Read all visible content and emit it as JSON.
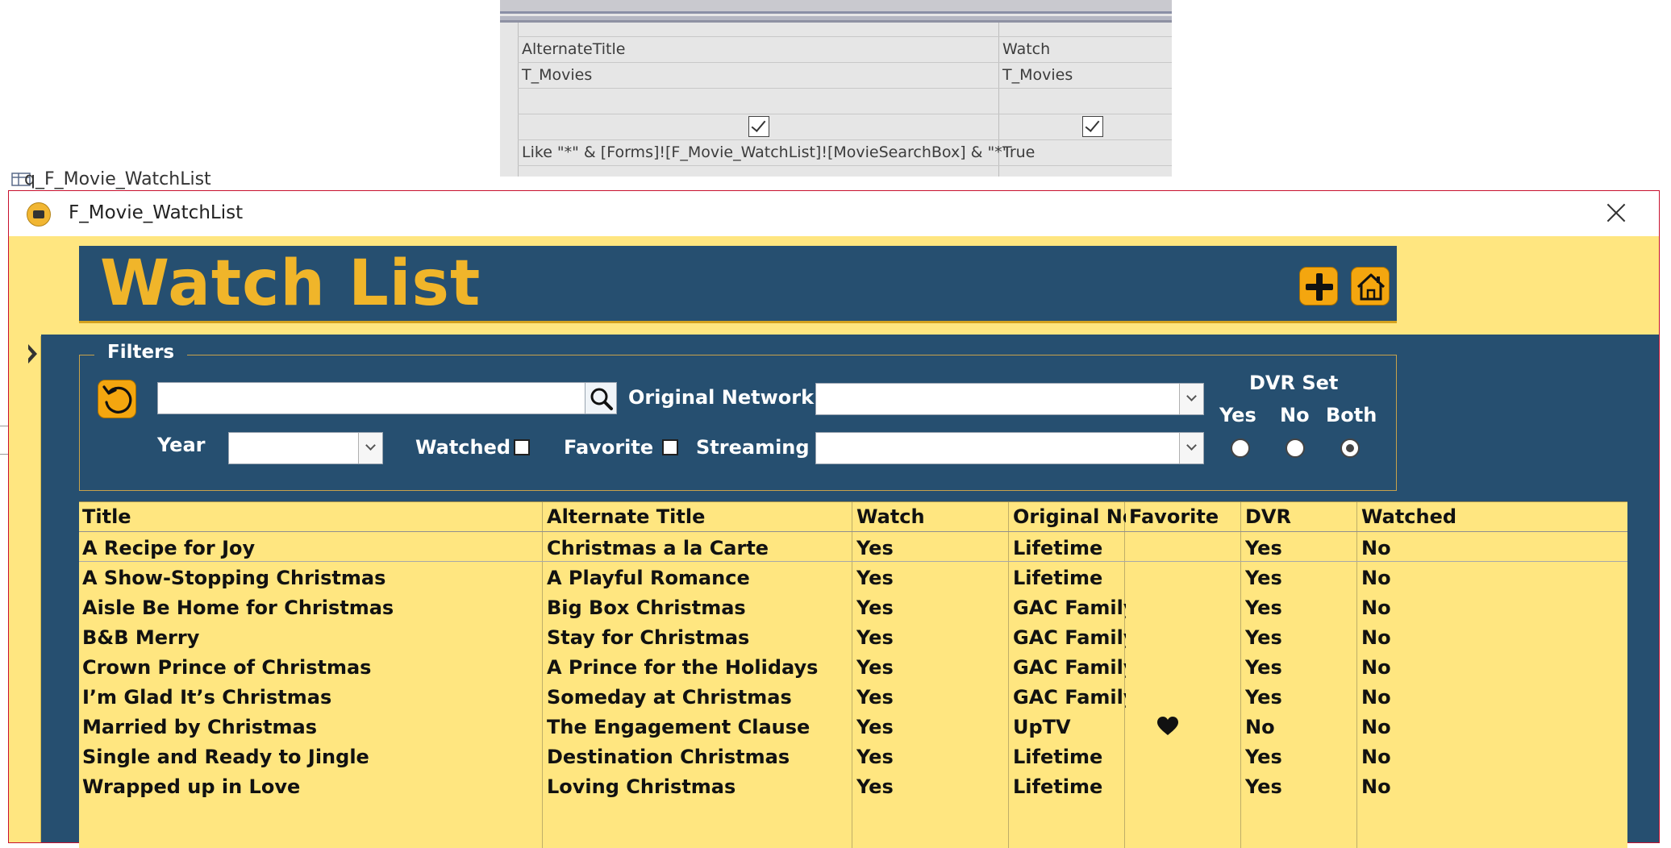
{
  "query_grid": {
    "columns": [
      {
        "field": "AlternateTitle",
        "table": "T_Movies",
        "show": true,
        "criteria": "Like \"*\" & [Forms]![F_Movie_WatchList]![MovieSearchBox] & \"*\""
      },
      {
        "field": "Watch",
        "table": "T_Movies",
        "show": true,
        "criteria": "True"
      }
    ]
  },
  "behind_window": {
    "title": "q_F_Movie_WatchList"
  },
  "form": {
    "title": "F_Movie_WatchList",
    "page_title": "Watch List",
    "icons": {
      "add": "plus-icon",
      "home": "home-icon",
      "reset": "undo-icon",
      "search": "search-icon",
      "close": "close-icon"
    }
  },
  "filters": {
    "legend": "Filters",
    "search_value": "",
    "original_network_label": "Original Network",
    "original_network_value": "",
    "year_label": "Year",
    "year_value": "",
    "watched_label": "Watched",
    "watched_checked": false,
    "favorite_label": "Favorite",
    "favorite_checked": false,
    "streaming_label": "Streaming",
    "streaming_value": "",
    "dvr_set": {
      "label": "DVR Set",
      "options": [
        "Yes",
        "No",
        "Both"
      ],
      "selected": "Both"
    }
  },
  "table": {
    "headers": [
      "Title",
      "Alternate Title",
      "Watch",
      "Original Network",
      "Favorite",
      "DVR",
      "Watched"
    ],
    "rows": [
      {
        "title": "A Recipe for Joy",
        "alternate_title": "Christmas a la Carte",
        "watch": "Yes",
        "network": "Lifetime",
        "favorite": false,
        "dvr": "Yes",
        "watched": "No"
      },
      {
        "title": "A Show-Stopping Christmas",
        "alternate_title": "A Playful Romance",
        "watch": "Yes",
        "network": "Lifetime",
        "favorite": false,
        "dvr": "Yes",
        "watched": "No"
      },
      {
        "title": "Aisle Be Home for Christmas",
        "alternate_title": "Big Box Christmas",
        "watch": "Yes",
        "network": "GAC Family",
        "favorite": false,
        "dvr": "Yes",
        "watched": "No"
      },
      {
        "title": "B&B Merry",
        "alternate_title": "Stay for Christmas",
        "watch": "Yes",
        "network": "GAC Family",
        "favorite": false,
        "dvr": "Yes",
        "watched": "No"
      },
      {
        "title": "Crown Prince of Christmas",
        "alternate_title": "A Prince for the Holidays",
        "watch": "Yes",
        "network": "GAC Family",
        "favorite": false,
        "dvr": "Yes",
        "watched": "No"
      },
      {
        "title": "I’m Glad It’s Christmas",
        "alternate_title": "Someday at Christmas",
        "watch": "Yes",
        "network": "GAC Family",
        "favorite": false,
        "dvr": "Yes",
        "watched": "No"
      },
      {
        "title": "Married by Christmas",
        "alternate_title": "The Engagement Clause",
        "watch": "Yes",
        "network": "UpTV",
        "favorite": true,
        "dvr": "No",
        "watched": "No"
      },
      {
        "title": "Single and Ready to Jingle",
        "alternate_title": "Destination Christmas",
        "watch": "Yes",
        "network": "Lifetime",
        "favorite": false,
        "dvr": "Yes",
        "watched": "No"
      },
      {
        "title": "Wrapped up in Love",
        "alternate_title": "Loving Christmas",
        "watch": "Yes",
        "network": "Lifetime",
        "favorite": false,
        "dvr": "Yes",
        "watched": "No"
      }
    ]
  },
  "colors": {
    "header_band": "#264f70",
    "title_gold": "#f0b52a",
    "form_bg": "#ffe680",
    "button_orange": "#f4a60f"
  }
}
